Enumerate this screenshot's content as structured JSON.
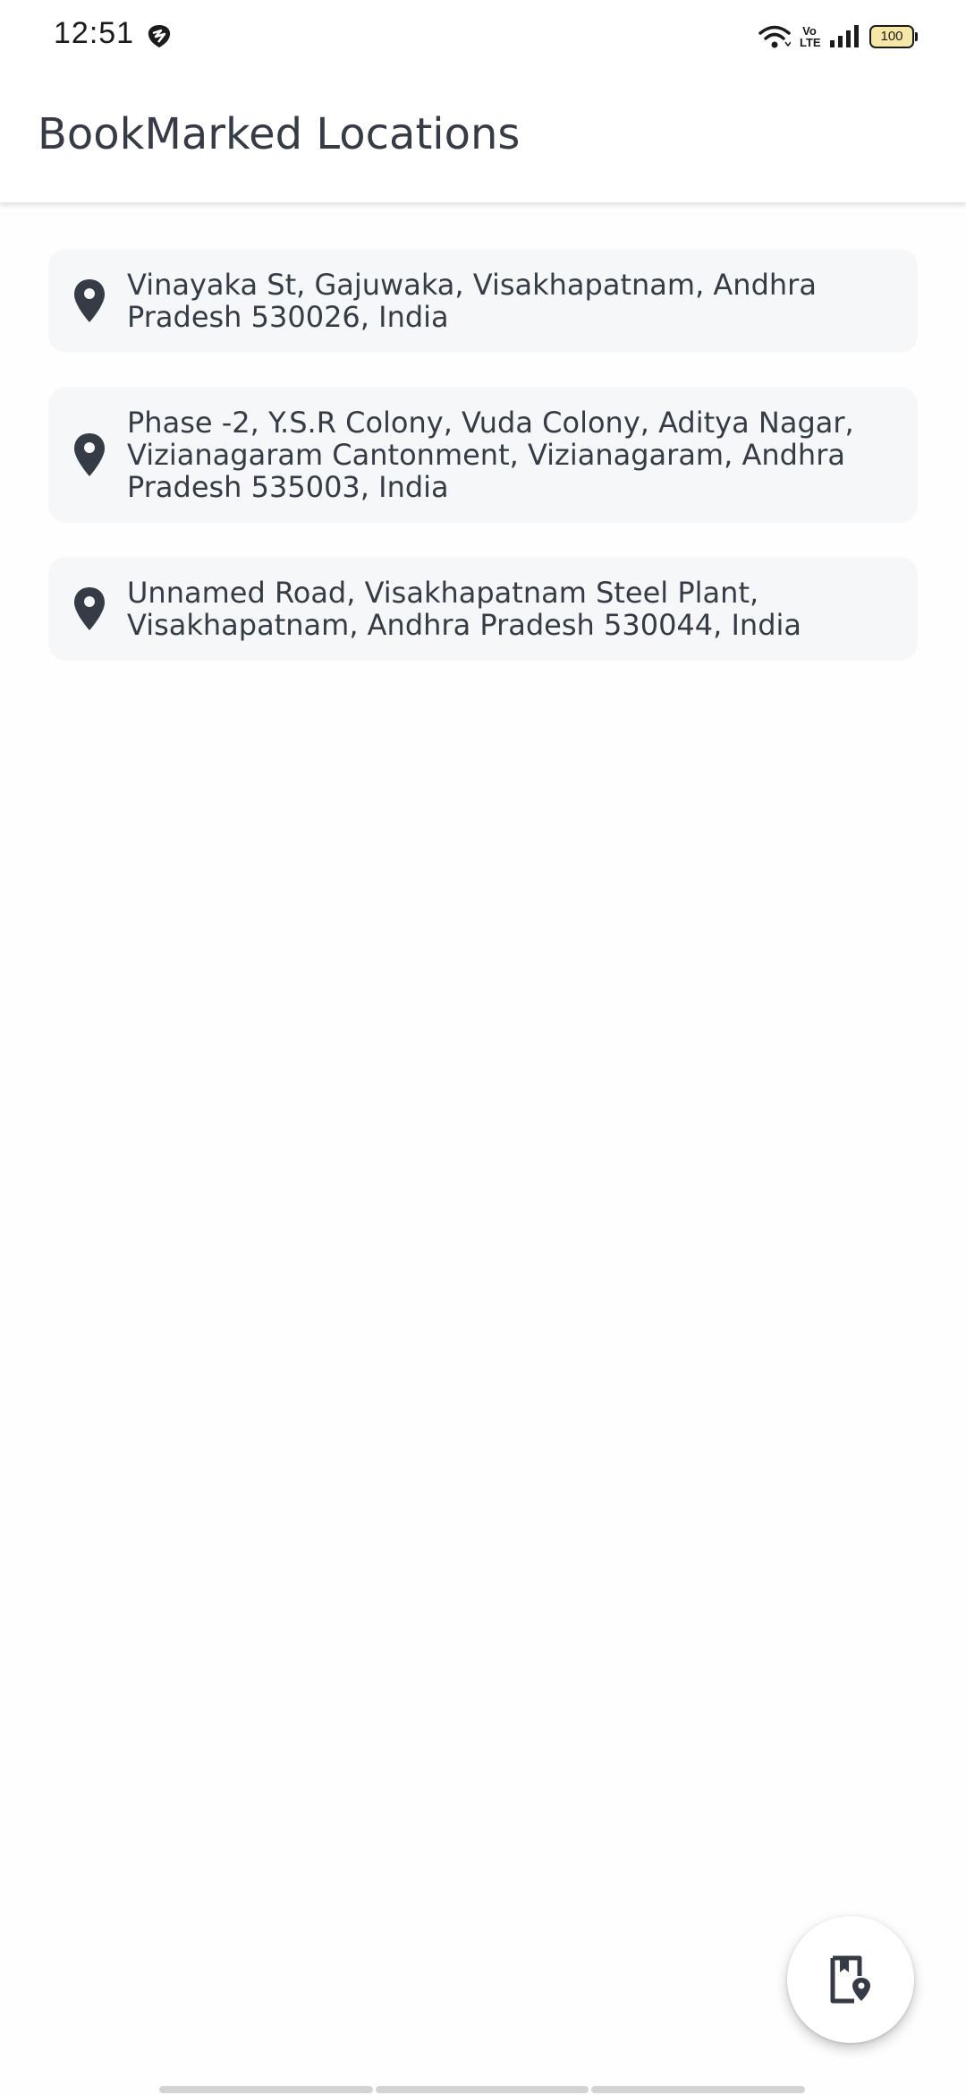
{
  "status_bar": {
    "time": "12:51",
    "volte_label": "Vo\nLTE",
    "battery": "100"
  },
  "app_bar": {
    "title": "BookMarked Locations"
  },
  "locations": [
    {
      "address": "Vinayaka St, Gajuwaka, Visakhapatnam, Andhra Pradesh 530026, India",
      "icon": "map-pin-icon"
    },
    {
      "address": "Phase -2, Y.S.R Colony, Vuda Colony, Aditya Nagar, Vizianagaram Cantonment, Vizianagaram, Andhra Pradesh 535003, India",
      "icon": "map-pin-icon"
    },
    {
      "address": "Unnamed Road, Visakhapatnam Steel Plant, Visakhapatnam, Andhra Pradesh 530044, India",
      "icon": "map-pin-icon"
    }
  ],
  "fab": {
    "icon": "bookmark-location-icon"
  },
  "colors": {
    "text": "#353c46",
    "card_bg": "#f6f7f9",
    "battery_fill": "#f6e7a6"
  }
}
